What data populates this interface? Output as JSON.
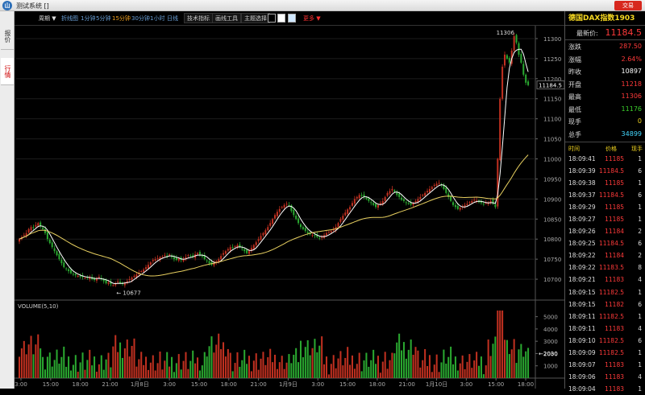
{
  "window": {
    "icon_label": "山",
    "title": "测试系统  []",
    "trade_button": "交易"
  },
  "sidebar": {
    "tabs": [
      {
        "label": "报价",
        "active": false
      },
      {
        "label": "行情",
        "active": true
      }
    ]
  },
  "toolbar": {
    "cycle": "周期 ▼",
    "periods": [
      "折线图",
      "1分钟",
      "5分钟",
      "15分钟",
      "30分钟",
      "1小时",
      "日线"
    ],
    "active_period": "15分钟",
    "tech_indicator": "技术指标",
    "drawing_tools": "画线工具",
    "theme_select": "主题选择",
    "more": "更多 ▼",
    "theme_colors": [
      "#000000",
      "#ffffff",
      "#d0e8ff"
    ]
  },
  "quote": {
    "symbol": "德国DAX指数1903",
    "last_label": "最新价:",
    "last_value": "11184.5",
    "fields": [
      {
        "label": "涨跌",
        "value": "287.50",
        "color": "#ff3a3a"
      },
      {
        "label": "涨幅",
        "value": "2.64%",
        "color": "#ff3a3a"
      },
      {
        "label": "昨收",
        "value": "10897",
        "color": "#ffffff"
      },
      {
        "label": "开盘",
        "value": "11218",
        "color": "#ff3a3a"
      },
      {
        "label": "最高",
        "value": "11306",
        "color": "#ff3a3a"
      },
      {
        "label": "最低",
        "value": "11176",
        "color": "#3cd02c"
      },
      {
        "label": "现手",
        "value": "0",
        "color": "#f6d820"
      },
      {
        "label": "总手",
        "value": "34899",
        "color": "#44d8ff"
      }
    ]
  },
  "ticks": {
    "headers": [
      "时间",
      "价格",
      "现手"
    ],
    "rows": [
      [
        "18:09:41",
        "11185",
        "1"
      ],
      [
        "18:09:39",
        "11184.5",
        "6"
      ],
      [
        "18:09:38",
        "11185",
        "1"
      ],
      [
        "18:09:37",
        "11184.5",
        "6"
      ],
      [
        "18:09:29",
        "11185",
        "1"
      ],
      [
        "18:09:27",
        "11185",
        "1"
      ],
      [
        "18:09:26",
        "11184",
        "2"
      ],
      [
        "18:09:25",
        "11184.5",
        "6"
      ],
      [
        "18:09:22",
        "11184",
        "2"
      ],
      [
        "18:09:22",
        "11183.5",
        "8"
      ],
      [
        "18:09:21",
        "11183",
        "4"
      ],
      [
        "18:09:15",
        "11182.5",
        "1"
      ],
      [
        "18:09:15",
        "11182",
        "6"
      ],
      [
        "18:09:11",
        "11182.5",
        "1"
      ],
      [
        "18:09:11",
        "11183",
        "4"
      ],
      [
        "18:09:10",
        "11182.5",
        "6"
      ],
      [
        "18:09:09",
        "11182.5",
        "1"
      ],
      [
        "18:09:07",
        "11183",
        "1"
      ],
      [
        "18:09:06",
        "11183",
        "4"
      ],
      [
        "18:09:04",
        "11183",
        "1"
      ]
    ]
  },
  "chart_data": {
    "type": "candlestick",
    "price_axis": {
      "min": 10650,
      "max": 11320,
      "ticks": [
        10700,
        10750,
        10800,
        10850,
        10900,
        10950,
        11000,
        11050,
        11100,
        11150,
        11200,
        11250,
        11300
      ]
    },
    "volume_axis": {
      "min": 0,
      "max": 5500,
      "ticks": [
        1000,
        2000,
        3000,
        4000,
        5000
      ]
    },
    "x_labels": [
      "3:00",
      "15:00",
      "18:00",
      "21:00",
      "1月8日",
      "3:00",
      "15:00",
      "18:00",
      "21:00",
      "1月9日",
      "3:00",
      "15:00",
      "18:00",
      "21:00",
      "1月10日",
      "3:00",
      "15:00",
      "18:00"
    ],
    "high_marker": "11306",
    "low_marker": "10677",
    "last_marker": "11184.5",
    "volume_title": "VOLUME(5,10)",
    "volume_marker": "2030",
    "ma_colors": [
      "#ffffff",
      "#e8d060"
    ],
    "up_color": "#c03020",
    "down_color": "#2aa830",
    "closes": [
      10800,
      10805,
      10810,
      10815,
      10825,
      10830,
      10828,
      10835,
      10840,
      10832,
      10825,
      10815,
      10800,
      10790,
      10780,
      10770,
      10760,
      10750,
      10740,
      10730,
      10725,
      10720,
      10715,
      10712,
      10710,
      10708,
      10706,
      10705,
      10704,
      10703,
      10705,
      10700,
      10698,
      10702,
      10706,
      10700,
      10695,
      10690,
      10692,
      10688,
      10685,
      10690,
      10695,
      10690,
      10688,
      10690,
      10695,
      10700,
      10704,
      10708,
      10712,
      10716,
      10720,
      10724,
      10730,
      10736,
      10742,
      10748,
      10750,
      10752,
      10755,
      10756,
      10760,
      10758,
      10762,
      10755,
      10750,
      10748,
      10752,
      10748,
      10750,
      10755,
      10760,
      10758,
      10756,
      10762,
      10765,
      10760,
      10758,
      10750,
      10745,
      10740,
      10736,
      10740,
      10745,
      10750,
      10758,
      10765,
      10770,
      10775,
      10780,
      10778,
      10782,
      10785,
      10780,
      10775,
      10770,
      10765,
      10770,
      10778,
      10785,
      10792,
      10800,
      10808,
      10815,
      10822,
      10830,
      10840,
      10850,
      10860,
      10868,
      10875,
      10880,
      10885,
      10888,
      10884,
      10870,
      10860,
      10850,
      10840,
      10830,
      10825,
      10820,
      10815,
      10812,
      10810,
      10808,
      10805,
      10802,
      10806,
      10810,
      10815,
      10818,
      10820,
      10825,
      10830,
      10840,
      10850,
      10858,
      10866,
      10874,
      10880,
      10890,
      10900,
      10905,
      10910,
      10908,
      10905,
      10900,
      10895,
      10890,
      10885,
      10880,
      10885,
      10890,
      10895,
      10905,
      10915,
      10920,
      10925,
      10918,
      10910,
      10905,
      10898,
      10895,
      10890,
      10888,
      10886,
      10890,
      10895,
      10900,
      10905,
      10910,
      10915,
      10920,
      10925,
      10930,
      10935,
      10938,
      10940,
      10935,
      10925,
      10915,
      10905,
      10895,
      10885,
      10880,
      10875,
      10878,
      10882,
      10885,
      10888,
      10892,
      10895,
      10898,
      10896,
      10892,
      10890,
      10888,
      10890,
      10892,
      10895,
      10888,
      10880,
      11000,
      11150,
      11230,
      11260,
      11250,
      11240,
      11270,
      11306,
      11290,
      11260,
      11240,
      11210,
      11190,
      11184
    ]
  }
}
